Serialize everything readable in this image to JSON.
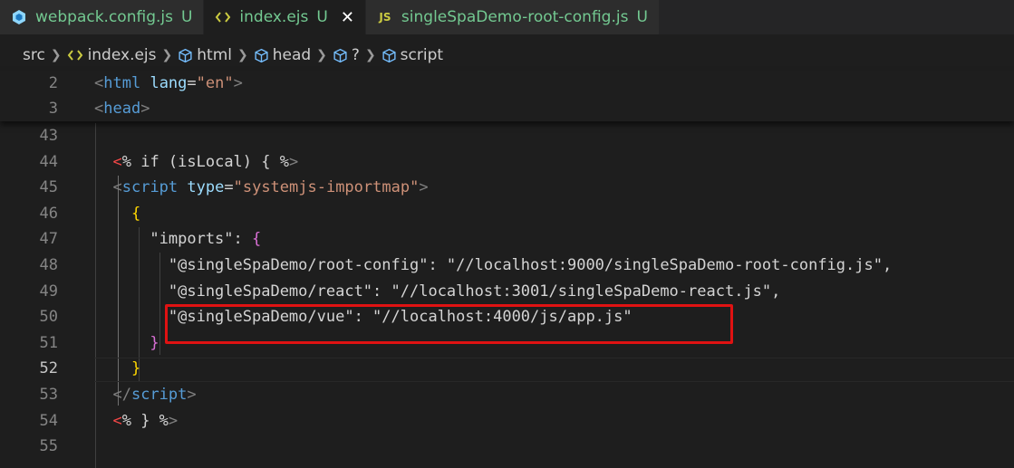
{
  "tabs": [
    {
      "icon": "webpack-icon",
      "label": "webpack.config.js",
      "status": "U",
      "active": false
    },
    {
      "icon": "ejs-brackets-icon",
      "label": "index.ejs",
      "status": "U",
      "active": true,
      "close": "✕"
    },
    {
      "icon": "js-icon",
      "label": "singleSpaDemo-root-config.js",
      "status": "U",
      "active": false
    }
  ],
  "breadcrumb": {
    "src": "src",
    "file": "index.ejs",
    "html": "html",
    "head": "head",
    "unknown": "?",
    "script": "script",
    "separator": ">"
  },
  "sticky_lines": [
    {
      "number": "2",
      "segments": [
        [
          "ang",
          "<"
        ],
        [
          "tag",
          "html"
        ],
        [
          "txt",
          " "
        ],
        [
          "attr",
          "lang"
        ],
        [
          "txt",
          "="
        ],
        [
          "str",
          "\"en\""
        ],
        [
          "ang",
          ">"
        ]
      ]
    },
    {
      "number": "3",
      "segments": [
        [
          "ang",
          "<"
        ],
        [
          "tag",
          "head"
        ],
        [
          "ang",
          ">"
        ]
      ]
    }
  ],
  "lines": [
    {
      "number": "43",
      "segments": []
    },
    {
      "number": "44",
      "segments": [
        [
          "txt",
          "  "
        ],
        [
          "ejs",
          "<"
        ],
        [
          "txt",
          "% if (isLocal) { %"
        ],
        [
          "ang",
          ">"
        ]
      ]
    },
    {
      "number": "45",
      "segments": [
        [
          "txt",
          "  "
        ],
        [
          "ang",
          "<"
        ],
        [
          "tag",
          "script"
        ],
        [
          "txt",
          " "
        ],
        [
          "attr",
          "type"
        ],
        [
          "txt",
          "="
        ],
        [
          "str",
          "\"systemjs-importmap\""
        ],
        [
          "ang",
          ">"
        ]
      ]
    },
    {
      "number": "46",
      "segments": [
        [
          "txt",
          "    "
        ],
        [
          "brace",
          "{"
        ]
      ]
    },
    {
      "number": "47",
      "segments": [
        [
          "txt",
          "      \"imports\": "
        ],
        [
          "brace2",
          "{"
        ]
      ]
    },
    {
      "number": "48",
      "segments": [
        [
          "txt",
          "        \"@singleSpaDemo/root-config\": \"//localhost:9000/singleSpaDemo-root-config.js\","
        ]
      ]
    },
    {
      "number": "49",
      "segments": [
        [
          "txt",
          "        \"@singleSpaDemo/react\": \"//localhost:3001/singleSpaDemo-react.js\","
        ]
      ]
    },
    {
      "number": "50",
      "segments": [
        [
          "txt",
          "        \"@singleSpaDemo/vue\": \"//localhost:4000/js/app.js\""
        ]
      ]
    },
    {
      "number": "51",
      "segments": [
        [
          "txt",
          "      "
        ],
        [
          "brace2",
          "}"
        ]
      ]
    },
    {
      "number": "52",
      "segments": [
        [
          "txt",
          "    "
        ],
        [
          "brace",
          "}"
        ]
      ],
      "current": true
    },
    {
      "number": "53",
      "segments": [
        [
          "txt",
          "  "
        ],
        [
          "ang",
          "</"
        ],
        [
          "tag",
          "script"
        ],
        [
          "ang",
          ">"
        ]
      ]
    },
    {
      "number": "54",
      "segments": [
        [
          "txt",
          "  "
        ],
        [
          "ejs",
          "<"
        ],
        [
          "txt",
          "% } %"
        ],
        [
          "ang",
          ">"
        ]
      ]
    },
    {
      "number": "55",
      "segments": []
    }
  ],
  "colors": {
    "background": "#1e1e1e",
    "untracked": "#73c991",
    "highlight_box": "#e01212"
  }
}
